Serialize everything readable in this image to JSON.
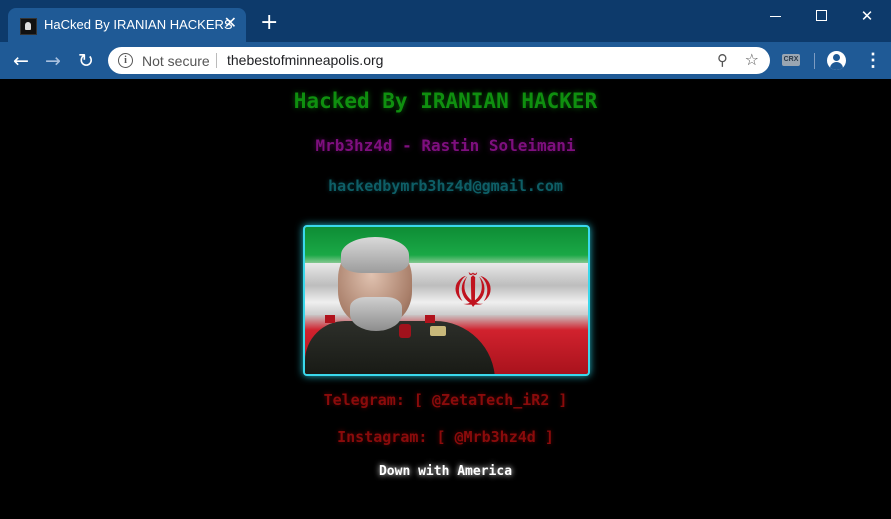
{
  "browser": {
    "tab": {
      "title": "HaCked By IRANIAN HACKERS",
      "close_label": "✕"
    },
    "new_tab_label": "+",
    "window_controls": {
      "close_label": "✕"
    },
    "nav": {
      "back_label": "←",
      "forward_label": "→",
      "reload_label": "↻"
    },
    "omnibox": {
      "security_label": "Not secure",
      "url": "thebestofminneapolis.org"
    },
    "extension_label": "CRX",
    "menu_label": "⋮"
  },
  "page": {
    "heading": "Hacked By IRANIAN HACKER",
    "author": "Mrb3hz4d - Rastin Soleimani",
    "email": "hackedbymrb3hz4d@gmail.com",
    "telegram": "Telegram: [ @ZetaTech_iR2 ]",
    "instagram": "Instagram: [ @Mrb3hz4d ]",
    "footer": "Down with America"
  },
  "colors": {
    "heading": "#0f8f0f",
    "author": "#7e0f7e",
    "email": "#0e5e66",
    "social": "#8a0b0b",
    "image_border": "#3ad8ec"
  }
}
